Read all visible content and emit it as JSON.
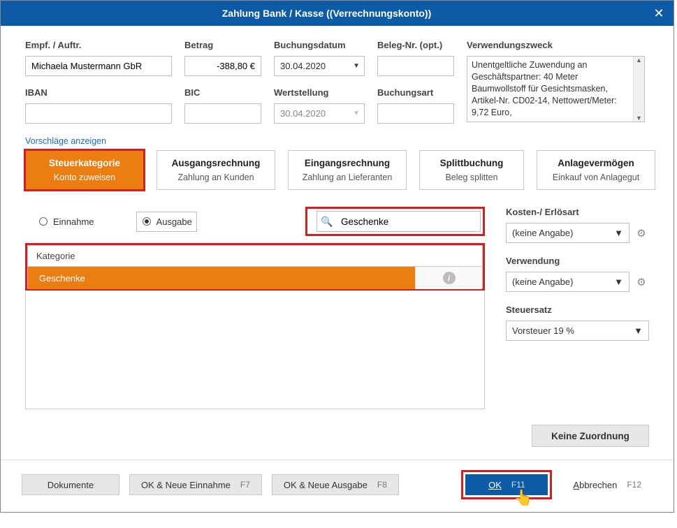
{
  "title": "Zahlung Bank / Kasse ((Verrechnungskonto))",
  "fields": {
    "empf_label": "Empf. / Auftr.",
    "empf_value": "Michaela Mustermann GbR",
    "betrag_label": "Betrag",
    "betrag_value": "-388,80 €",
    "buchungsdatum_label": "Buchungsdatum",
    "buchungsdatum_value": "30.04.2020",
    "belegnr_label": "Beleg-Nr. (opt.)",
    "belegnr_value": "",
    "zweck_label": "Verwendungszweck",
    "zweck_value": "Unentgeltliche Zuwendung an Geschäftspartner: 40 Meter Baumwollstoff für Gesichtsmasken, Artikel-Nr. CD02-14, Nettowert/Meter: 9,72 Euro,",
    "iban_label": "IBAN",
    "iban_value": "",
    "bic_label": "BIC",
    "bic_value": "",
    "wertstellung_label": "Wertstellung",
    "wertstellung_value": "30.04.2020",
    "buchungsart_label": "Buchungsart",
    "buchungsart_value": ""
  },
  "suggest_link": "Vorschläge anzeigen",
  "cats": [
    {
      "t1": "Steuerkategorie",
      "t2": "Konto zuweisen"
    },
    {
      "t1": "Ausgangsrechnung",
      "t2": "Zahlung an Kunden"
    },
    {
      "t1": "Eingangsrechnung",
      "t2": "Zahlung an Lieferanten"
    },
    {
      "t1": "Splittbuchung",
      "t2": "Beleg splitten"
    },
    {
      "t1": "Anlagevermögen",
      "t2": "Einkauf von Anlagegut"
    }
  ],
  "radios": {
    "einnahme": "Einnahme",
    "ausgabe": "Ausgabe"
  },
  "search_value": "Geschenke",
  "grid": {
    "header": "Kategorie",
    "row": "Geschenke"
  },
  "right": {
    "kosten_label": "Kosten-/ Erlösart",
    "kosten_value": "(keine Angabe)",
    "verwendung_label": "Verwendung",
    "verwendung_value": "(keine Angabe)",
    "steuer_label": "Steuersatz",
    "steuer_value": "Vorsteuer 19 %"
  },
  "no_assign": "Keine Zuordnung",
  "footer": {
    "dokumente": "Dokumente",
    "ok_einnahme": "OK & Neue Einnahme",
    "ok_einnahme_fk": "F7",
    "ok_ausgabe": "OK & Neue Ausgabe",
    "ok_ausgabe_fk": "F8",
    "ok": "OK",
    "ok_fk": "F11",
    "abbrechen": "Abbrechen",
    "abbrechen_fk": "F12"
  }
}
